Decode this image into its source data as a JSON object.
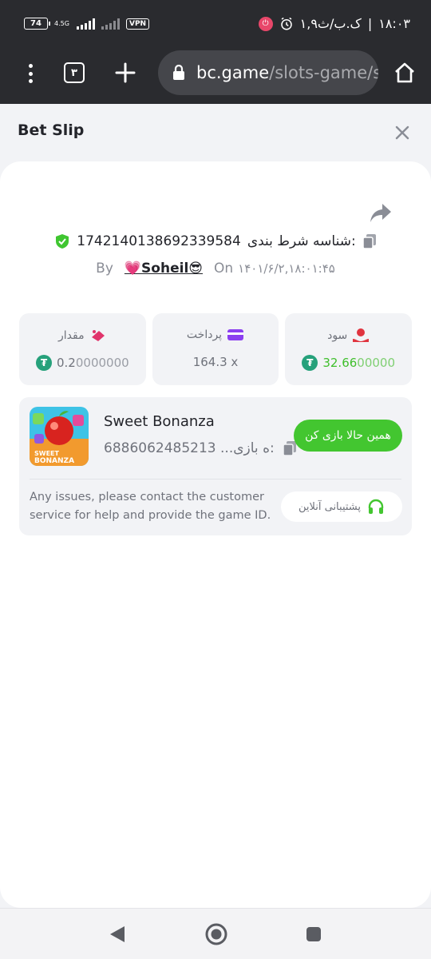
{
  "status_bar": {
    "battery": "74",
    "network": "4.5G",
    "vpn": "VPN",
    "date": "۱,۹ک.ب/ث",
    "time": "۱۸:۰۳"
  },
  "browser": {
    "tab_count": "۳",
    "url_domain": "bc.game",
    "url_path": "/slots-game/s"
  },
  "bet_slip": {
    "title": "Bet Slip",
    "bet_id_label": "شناسه شرط بندی:",
    "bet_id": "1742140138692339584",
    "by_label": "By",
    "username": "💗Soheil😎",
    "on_label": "On",
    "date": "۱۴۰۱/۶/۲,۱۸:۰۱:۴۵"
  },
  "stats": [
    {
      "label": "سود",
      "value_main": "32.66",
      "value_dim": "00000",
      "icon": "profit-icon",
      "currency": "usdt"
    },
    {
      "label": "پرداخت",
      "value_main": "164.3 x",
      "value_dim": "",
      "icon": "payout-card-icon",
      "currency": ""
    },
    {
      "label": "مقدار",
      "value_main": "0.2",
      "value_dim": "0000000",
      "icon": "amount-icon",
      "currency": "usdt"
    }
  ],
  "game": {
    "name": "Sweet Bonanza",
    "id_label": "...ه بازی:",
    "id": "6886062485213",
    "play_button": "همین حالا بازی کن",
    "thumb_text_1": "SWEET",
    "thumb_text_2": "BONANZA",
    "issue_text": "Any issues, please contact the customer service for help and provide the game ID.",
    "support_button": "پشتیبانی آنلاین"
  },
  "colors": {
    "accent_green": "#43c630",
    "tether_green": "#26a17b",
    "dark_bar": "#2a2b2f",
    "shield_green": "#3fc630",
    "payout_purple": "#8b3ff0",
    "profit_red": "#e0343f",
    "amount_pink": "#e0346b"
  }
}
